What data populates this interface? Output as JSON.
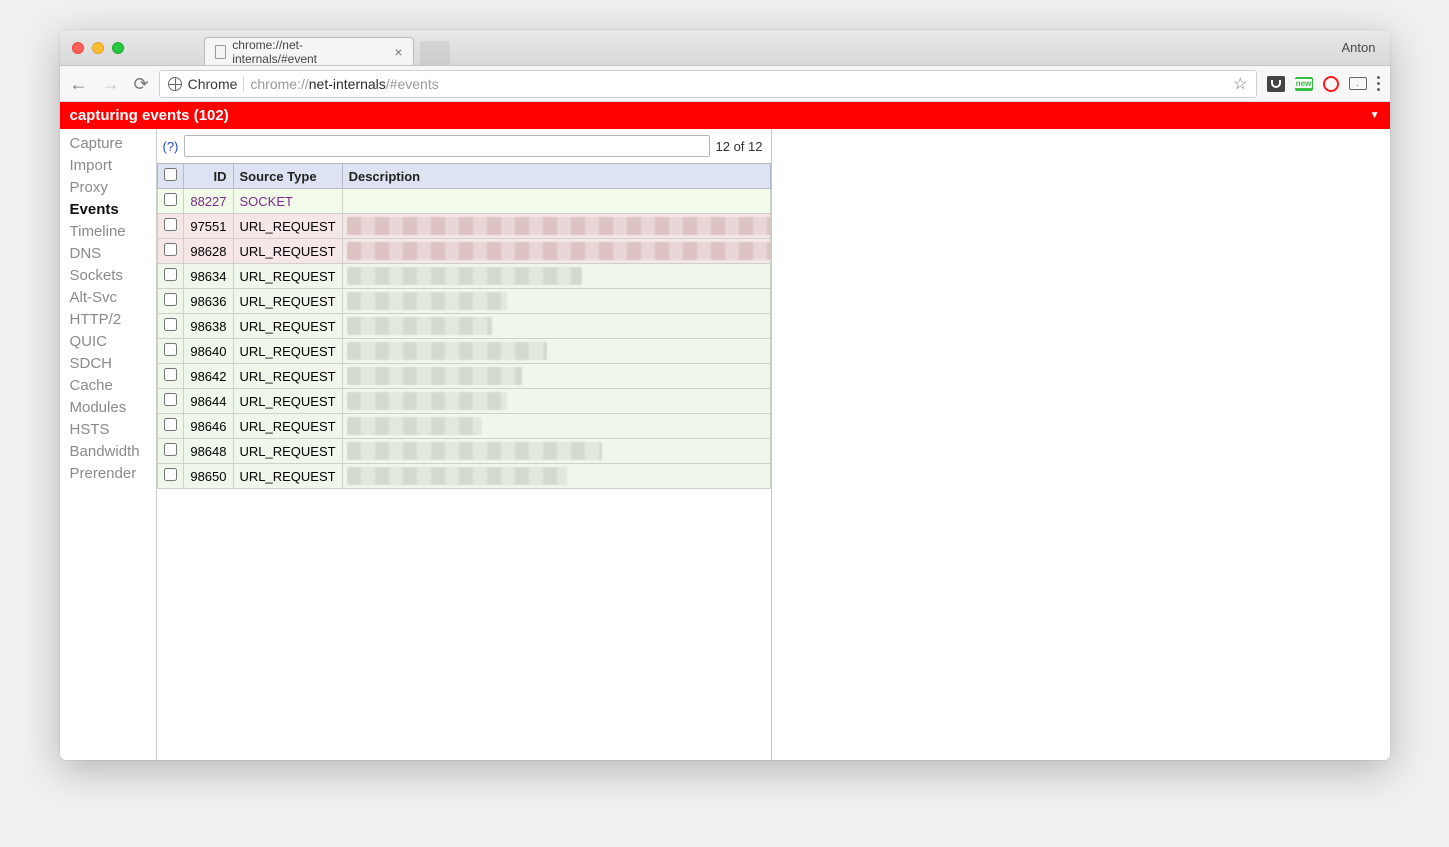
{
  "window": {
    "profile_name": "Anton",
    "tab_title": "chrome://net-internals/#event"
  },
  "toolbar": {
    "scheme_label": "Chrome",
    "url_dim1": "chrome://",
    "url_strong": "net-internals",
    "url_dim2": "/#events"
  },
  "banner": {
    "text": "capturing events (102)"
  },
  "sidebar": {
    "items": [
      {
        "label": "Capture",
        "active": false
      },
      {
        "label": "Import",
        "active": false
      },
      {
        "label": "Proxy",
        "active": false
      },
      {
        "label": "Events",
        "active": true
      },
      {
        "label": "Timeline",
        "active": false
      },
      {
        "label": "DNS",
        "active": false
      },
      {
        "label": "Sockets",
        "active": false
      },
      {
        "label": "Alt-Svc",
        "active": false
      },
      {
        "label": "HTTP/2",
        "active": false
      },
      {
        "label": "QUIC",
        "active": false
      },
      {
        "label": "SDCH",
        "active": false
      },
      {
        "label": "Cache",
        "active": false
      },
      {
        "label": "Modules",
        "active": false
      },
      {
        "label": "HSTS",
        "active": false
      },
      {
        "label": "Bandwidth",
        "active": false
      },
      {
        "label": "Prerender",
        "active": false
      }
    ]
  },
  "filter": {
    "help": "(?)",
    "value": "",
    "count": "12 of 12"
  },
  "table": {
    "headers": {
      "id": "ID",
      "source": "Source Type",
      "desc": "Description"
    },
    "rows": [
      {
        "id": "88227",
        "source": "SOCKET",
        "kind": "socket",
        "blur_w": 0
      },
      {
        "id": "97551",
        "source": "URL_REQUEST",
        "kind": "error",
        "blur_w": 440
      },
      {
        "id": "98628",
        "source": "URL_REQUEST",
        "kind": "error",
        "blur_w": 440
      },
      {
        "id": "98634",
        "source": "URL_REQUEST",
        "kind": "normal",
        "blur_w": 235
      },
      {
        "id": "98636",
        "source": "URL_REQUEST",
        "kind": "normal",
        "blur_w": 160
      },
      {
        "id": "98638",
        "source": "URL_REQUEST",
        "kind": "normal",
        "blur_w": 145
      },
      {
        "id": "98640",
        "source": "URL_REQUEST",
        "kind": "normal",
        "blur_w": 200
      },
      {
        "id": "98642",
        "source": "URL_REQUEST",
        "kind": "normal",
        "blur_w": 175
      },
      {
        "id": "98644",
        "source": "URL_REQUEST",
        "kind": "normal",
        "blur_w": 160
      },
      {
        "id": "98646",
        "source": "URL_REQUEST",
        "kind": "normal",
        "blur_w": 135
      },
      {
        "id": "98648",
        "source": "URL_REQUEST",
        "kind": "normal",
        "blur_w": 255
      },
      {
        "id": "98650",
        "source": "URL_REQUEST",
        "kind": "normal",
        "blur_w": 220
      }
    ]
  }
}
